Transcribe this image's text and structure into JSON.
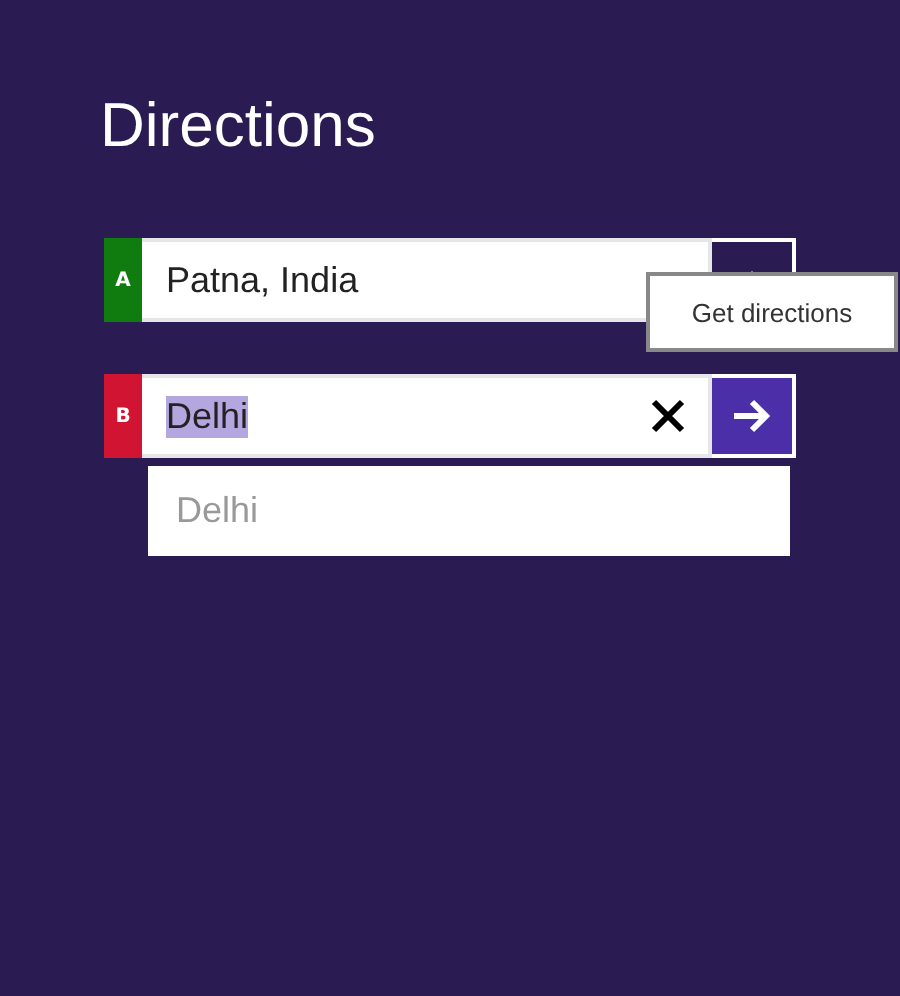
{
  "title": "Directions",
  "waypoints": [
    {
      "marker": "A",
      "color": "#107c10",
      "value": "Patna, India",
      "text_selected": false,
      "clear_button": false,
      "kind": "swap"
    },
    {
      "marker": "B",
      "color": "#d01432",
      "value": "Delhi",
      "text_selected": true,
      "clear_button": true,
      "kind": "go"
    }
  ],
  "suggestions": [
    "Delhi"
  ],
  "tooltip": "Get directions"
}
